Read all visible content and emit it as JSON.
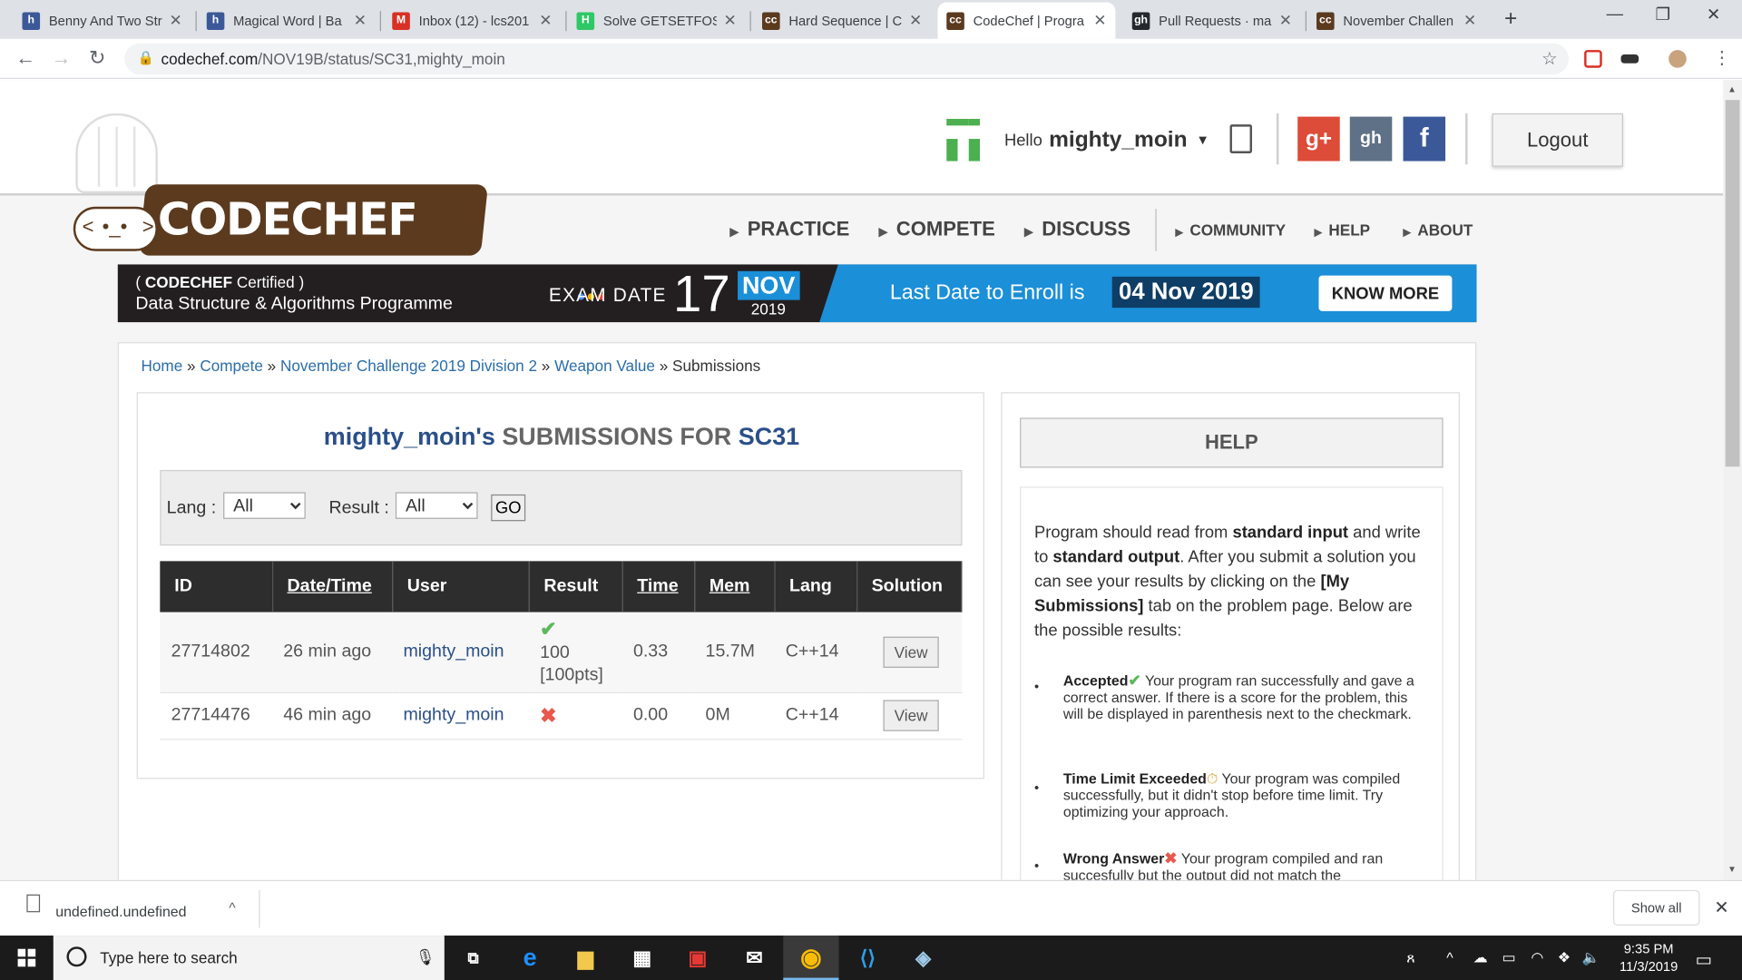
{
  "browser": {
    "tabs": [
      {
        "title": "Benny And Two Str",
        "favicon": "h",
        "favicon_color": "#3b5998"
      },
      {
        "title": "Magical Word | Ba",
        "favicon": "h",
        "favicon_color": "#3b5998"
      },
      {
        "title": "Inbox (12) - lcs201",
        "favicon": "M",
        "favicon_color": "#d93025"
      },
      {
        "title": "Solve GETSETFOSS",
        "favicon": "H",
        "favicon_color": "#2ec866"
      },
      {
        "title": "Hard Sequence | C",
        "favicon": "cc",
        "favicon_color": "#5b3a1e"
      },
      {
        "title": "CodeChef | Progra",
        "favicon": "cc",
        "favicon_color": "#5b3a1e"
      },
      {
        "title": "Pull Requests · ma",
        "favicon": "gh",
        "favicon_color": "#24292e"
      },
      {
        "title": "November Challen",
        "favicon": "cc",
        "favicon_color": "#5b3a1e"
      }
    ],
    "url_host": "codechef.com",
    "url_path": "/NOV19B/status/SC31,mighty_moin"
  },
  "header": {
    "hello": "Hello",
    "username": "mighty_moin",
    "logout": "Logout",
    "logo_text": "CODECHEF",
    "social": {
      "google": "g+",
      "github": "gh",
      "facebook": "f"
    }
  },
  "nav": {
    "main": [
      "PRACTICE",
      "COMPETE",
      "DISCUSS"
    ],
    "sub": [
      "COMMUNITY",
      "HELP",
      "ABOUT"
    ]
  },
  "banner": {
    "brand": "CODECHEF",
    "certified": "Certified",
    "program": "Data Structure & Algorithms Programme",
    "exam_date_label": "EXAM DATE",
    "day": "17",
    "month": "NOV",
    "year": "2019",
    "last_date_label": "Last Date to Enroll is",
    "last_date": "04 Nov 2019",
    "cta": "KNOW MORE"
  },
  "breadcrumb": {
    "items": [
      "Home",
      "Compete",
      "November Challenge 2019 Division 2",
      "Weapon Value"
    ],
    "current": "Submissions",
    "sep": "»"
  },
  "submissions": {
    "title_user": "mighty_moin's",
    "title_mid": "SUBMISSIONS FOR",
    "title_problem": "SC31",
    "filter": {
      "lang_label": "Lang :",
      "lang_value": "All",
      "result_label": "Result :",
      "result_value": "All",
      "go": "GO"
    },
    "columns": [
      "ID",
      "Date/Time",
      "User",
      "Result",
      "Time",
      "Mem",
      "Lang",
      "Solution"
    ],
    "rows": [
      {
        "id": "27714802",
        "datetime": "26 min ago",
        "user": "mighty_moin",
        "result_icon": "check-icon",
        "result_text": "100",
        "result_pts": "[100pts]",
        "time": "0.33",
        "mem": "15.7M",
        "lang": "C++14",
        "solution": "View"
      },
      {
        "id": "27714476",
        "datetime": "46 min ago",
        "user": "mighty_moin",
        "result_icon": "cross-icon",
        "result_text": "",
        "result_pts": "",
        "time": "0.00",
        "mem": "0M",
        "lang": "C++14",
        "solution": "View"
      }
    ]
  },
  "help": {
    "title": "HELP",
    "intro": {
      "p1": "Program should read from ",
      "b1": "standard input",
      "p2": " and write to ",
      "b2": "standard output",
      "p3": ". After you submit a solution you can see your results by clicking on the ",
      "b3": "[My Submissions]",
      "p4": " tab on the problem page. Below are the possible results:"
    },
    "items": [
      {
        "name": "Accepted",
        "icon": "check-icon",
        "text": " Your program ran successfully and gave a correct answer. If there is a score for the problem, this will be displayed in parenthesis next to the checkmark."
      },
      {
        "name": "Time Limit Exceeded",
        "icon": "clock-icon",
        "text": " Your program was compiled successfully, but it didn't stop before time limit. Try optimizing your approach."
      },
      {
        "name": "Wrong Answer",
        "icon": "cross-icon",
        "text": " Your program compiled and ran succesfully but the output did not match the"
      }
    ]
  },
  "downloads": {
    "file": "undefined.undefined",
    "show_all": "Show all"
  },
  "taskbar": {
    "search_placeholder": "Type here to search",
    "time": "9:35 PM",
    "date": "11/3/2019"
  }
}
